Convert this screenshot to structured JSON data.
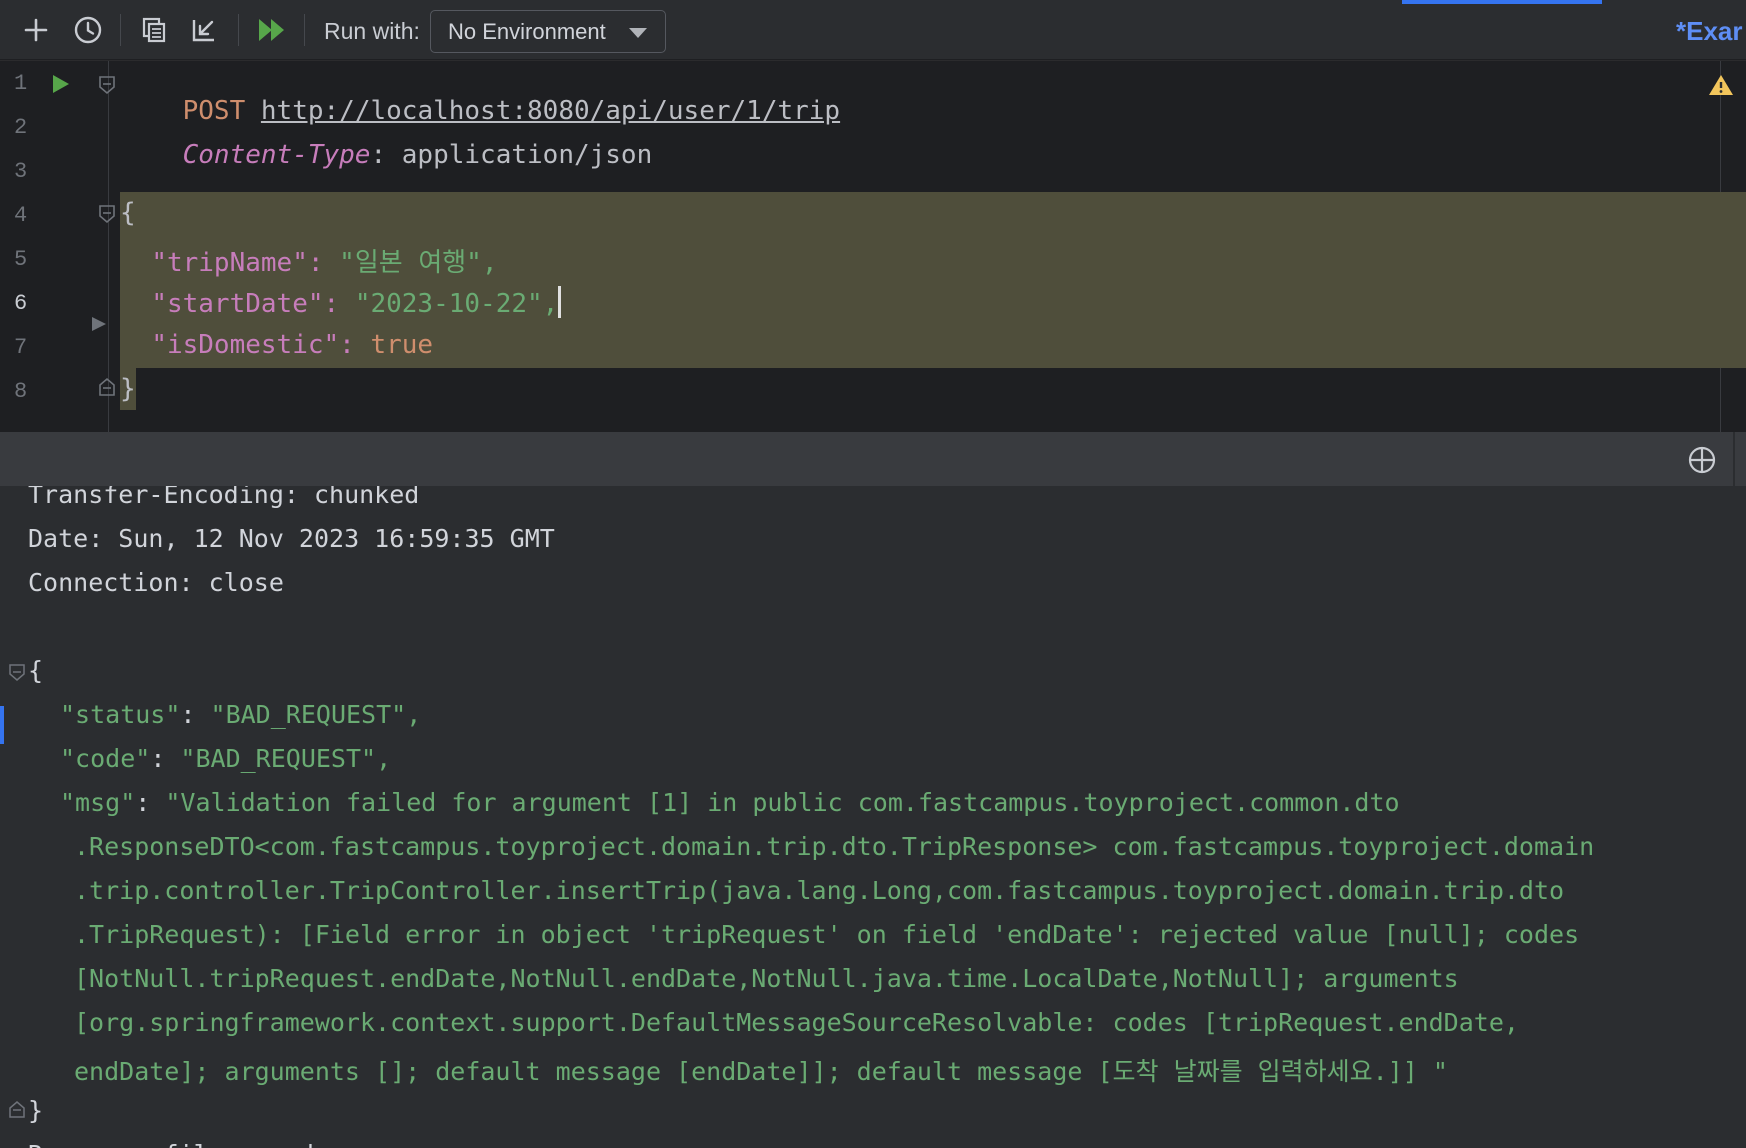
{
  "toolbar": {
    "icons": [
      "plus-icon",
      "history-icon",
      "copy-icon",
      "import-icon",
      "run-all-icon"
    ],
    "run_with_label": "Run with:",
    "environment": "No Environment",
    "tab_title": "*Exar"
  },
  "editor": {
    "line_numbers": [
      "1",
      "2",
      "3",
      "4",
      "5",
      "6",
      "7",
      "8"
    ],
    "method": "POST",
    "url": "http://localhost:8080/api/user/1/trip",
    "header_name": "Content-Type",
    "header_sep": ": ",
    "header_value": "application/json",
    "open_brace": "{",
    "close_brace": "}",
    "fields": [
      {
        "key": "\"tripName\"",
        "sep": ": ",
        "value": "\"일본 여행\"",
        "end": ","
      },
      {
        "key": "\"startDate\"",
        "sep": ": ",
        "value": "\"2023-10-22\"",
        "end": ","
      },
      {
        "key": "\"isDomestic\"",
        "sep": ": ",
        "value": "true",
        "end": ""
      }
    ]
  },
  "response": {
    "headers": [
      "Transfer-Encoding: chunked",
      "Date: Sun, 12 Nov 2023 16:59:35 GMT",
      "Connection: close"
    ],
    "open_brace": "{",
    "close_brace": "}",
    "status_key": "\"status\"",
    "status_value": "\"BAD_REQUEST\",",
    "code_key": "\"code\"",
    "code_value": "\"BAD_REQUEST\",",
    "msg_key": "\"msg\"",
    "msg_lines": [
      "\"Validation failed for argument [1] in public com.fastcampus.toyproject.common.dto",
      ".ResponseDTO<com.fastcampus.toyproject.domain.trip.dto.TripResponse> com.fastcampus.toyproject.domain",
      ".trip.controller.TripController.insertTrip(java.lang.Long,com.fastcampus.toyproject.domain.trip.dto",
      ".TripRequest): [Field error in object 'tripRequest' on field 'endDate': rejected value [null]; codes",
      "[NotNull.tripRequest.endDate,NotNull.endDate,NotNull.java.time.LocalDate,NotNull]; arguments",
      "[org.springframework.context.support.DefaultMessageSourceResolvable: codes [tripRequest.endDate,",
      "endDate]; arguments []; default message [endDate]]; default message [도착 날짜를 입력하세요.]] \""
    ],
    "trailing_line": "Response file saved."
  }
}
